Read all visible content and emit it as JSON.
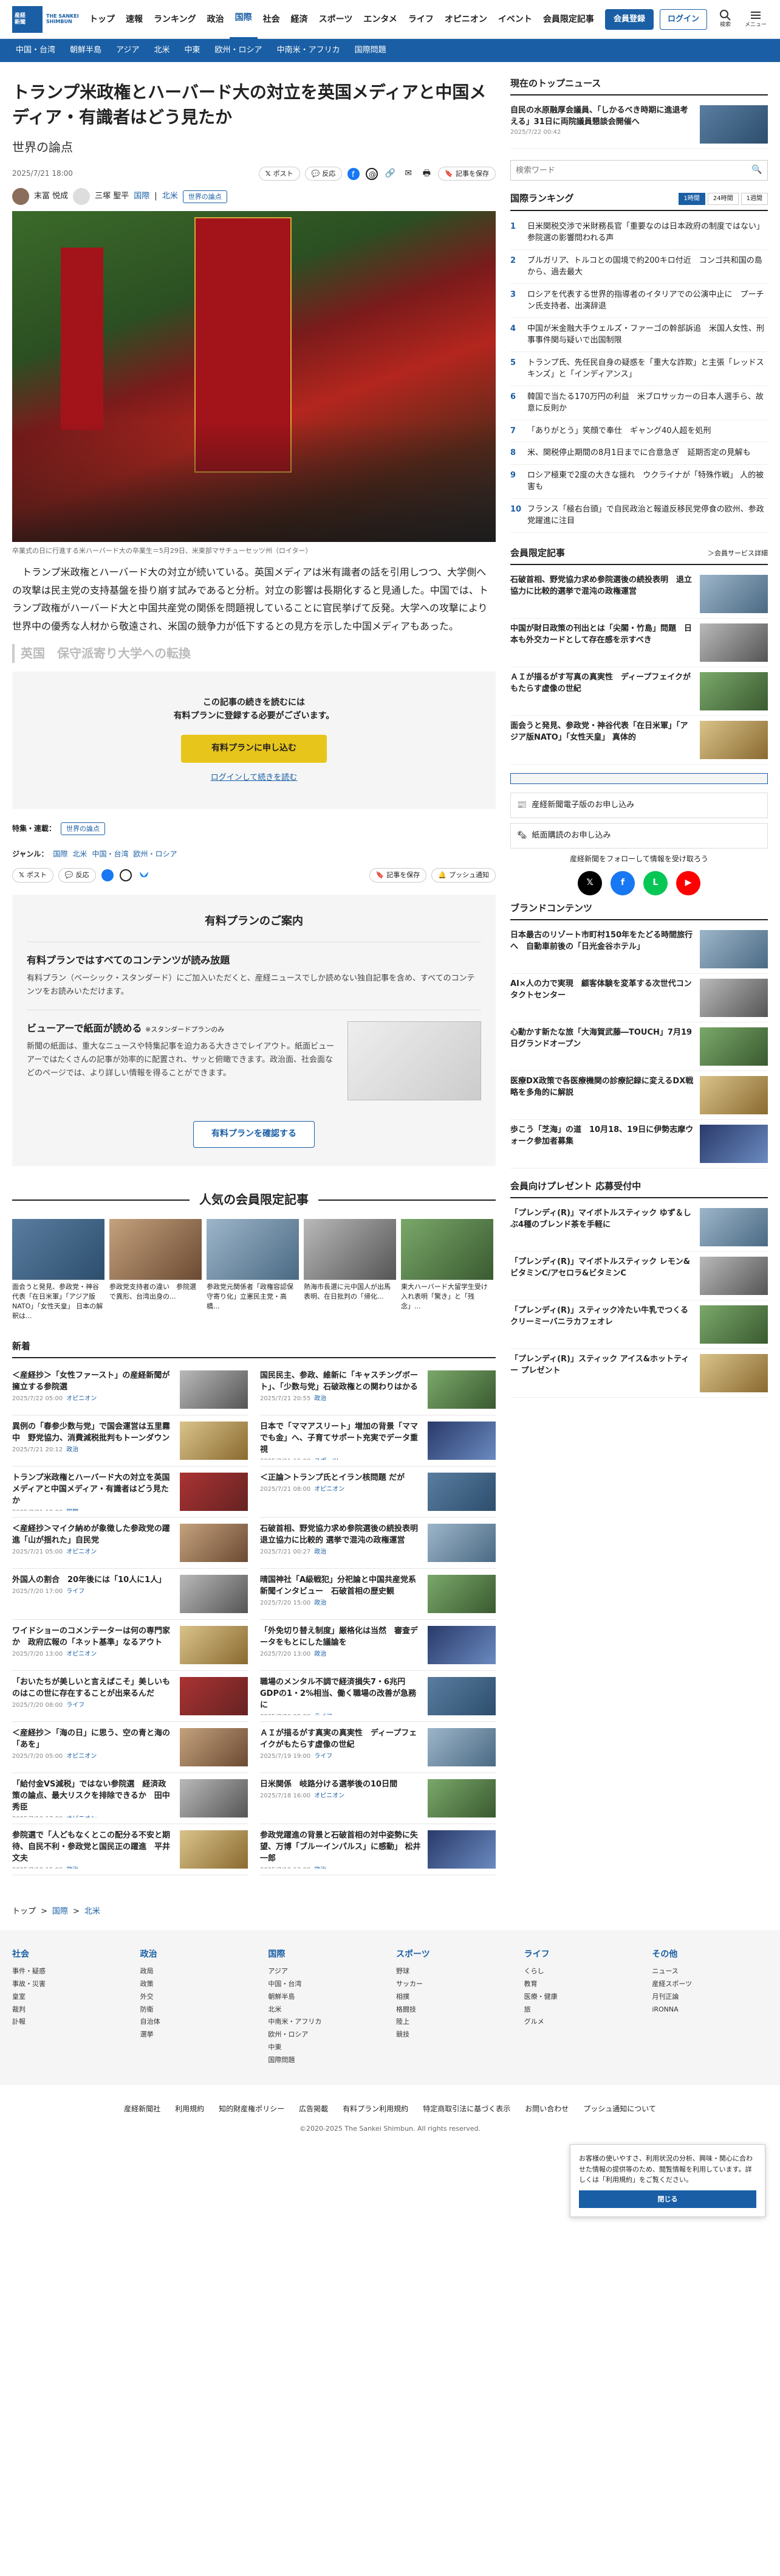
{
  "header": {
    "logo_line1": "産経",
    "logo_line2": "新聞",
    "logo_en": "THE SANKEI SHIMBUN",
    "nav": [
      "トップ",
      "速報",
      "ランキング",
      "政治",
      "国際",
      "社会",
      "経済",
      "スポーツ",
      "エンタメ",
      "ライフ",
      "オピニオン",
      "イベント",
      "会員限定記事"
    ],
    "member_btn": "会員登録",
    "login_btn": "ログイン",
    "search_label": "検索",
    "menu_label": "メニュー"
  },
  "subnav": [
    "中国・台湾",
    "朝鮮半島",
    "アジア",
    "北米",
    "中東",
    "欧州・ロシア",
    "中南米・アフリカ",
    "国際問題"
  ],
  "article": {
    "title": "トランプ米政権とハーバード大の対立を英国メディアと中国メディア・有識者はどう見たか",
    "subtitle": "世界の論点",
    "date": "2025/7/21 18:00",
    "post": "ポスト",
    "repost": "反応",
    "save": "記事を保存",
    "author1": "末冨 悦成",
    "author2": "三塚 聖平",
    "cat1": "国際",
    "cat2": "北米",
    "tag": "世界の論点",
    "caption": "卒業式の日に行進する米ハーバード大の卒業生＝5月29日、米東部マサチューセッツ州（ロイター）",
    "para1": "トランプ米政権とハーバード大の対立が続いている。英国メディアは米有識者の話を引用しつつ、大学側への攻撃は民主党の支持基盤を掛り崩す試みであると分析。対立の影響は長期化すると見通した。中国では、トランプ政権がハーバード大と中国共産党の関係を問題視していることに官民挙げて反発。大学への攻撃により世界中の優秀な人材から敬遠され、米国の競争力が低下するとの見方を示した中国メディアもあった。",
    "fade_heading": "英国　保守派寄り大学への転換",
    "pay_line1": "この記事の続きを読むには",
    "pay_line2": "有料プランに登録する必要がございます。",
    "pay_btn": "有料プランに申し込む",
    "pay_login": "ログインして続きを読む",
    "feature_label": "特集・連載：",
    "feature_tag": "世界の論点",
    "genre_label": "ジャンル：",
    "genres": [
      "国際",
      "北米",
      "中国・台湾",
      "欧州・ロシア"
    ],
    "save2": "記事を保存",
    "push": "プッシュ通知"
  },
  "plans": {
    "title": "有料プランのご案内",
    "h1": "有料プランではすべてのコンテンツが読み放題",
    "p1": "有料プラン（ベーシック・スタンダード）にご加入いただくと、産経ニュースでしか読めない独自記事を含め、すべてのコンテンツをお読みいただけます。",
    "h2": "ビューアーで紙面が読める",
    "h2note": "※スタンダードプランのみ",
    "p2": "新聞の紙面は、重大なニュースや特集記事を迫力ある大きさでレイアウト。紙面ビューアーではたくさんの記事が効率的に配置され、サッと俯瞰できます。政治面、社会面などのページでは、より詳しい情報を得ることができます。",
    "btn": "有料プランを確認する"
  },
  "popular": {
    "title": "人気の会員限定記事",
    "items": [
      "面会うと発見、参政党・神谷代表「在日米軍」「アジア版NATO」「女性天皇」 日本の解釈は...",
      "参政党支持者の違い　参院選で異形、台湾出身の...",
      "参政党元関係者「政権容認保守寄り化」立憲民主党・高橋...",
      "熱海市長選に元中国人が出馬表明、在日批判の「帰化...",
      "東大ハーバード大留学生受け入れ表明「驚き」と「残念」..."
    ]
  },
  "news": {
    "title": "新着",
    "items": [
      {
        "t": "＜産経抄＞「女性ファースト」の産経新聞が擁立する参院選",
        "d": "2025/7/22 05:00",
        "c": "オピニオン"
      },
      {
        "t": "国民民主、参政、維新に「キャスチングボート」、「少数与党」石破政権との関わりはかる",
        "d": "2025/7/21 20:55",
        "c": "政治"
      },
      {
        "t": "異例の「春参少数与党」で国会運営は五里霧中　野党協力、消費減税批判もトーンダウン",
        "d": "2025/7/21 20:12",
        "c": "政治"
      },
      {
        "t": "日本で「ママアスリート」増加の背景「ママでも金」へ、子育てサポート充実でデータ重視",
        "d": "2025/7/21 19:00",
        "c": "スポーツ"
      },
      {
        "t": "トランプ米政権とハーバード大の対立を英国メディアと中国メディア・有識者はどう見たか",
        "d": "2025/7/21 18:00",
        "c": "国際"
      },
      {
        "t": "＜正論＞トランプ氏とイラン核問題 だが",
        "d": "2025/7/21 08:00",
        "c": "オピニオン"
      },
      {
        "t": "＜産経抄＞マイク納めが象徴した参政党の躍進「山が揺れた」自民党",
        "d": "2025/7/21 05:00",
        "c": "オピニオン"
      },
      {
        "t": "石破首相、野党協力求め参院選後の続投表明　退立協力に比較的 選挙で混沌の政権運営",
        "d": "2025/7/21 00:27",
        "c": "政治"
      },
      {
        "t": "外国人の割合　20年後には「10人に1人」",
        "d": "2025/7/20 17:00",
        "c": "ライフ"
      },
      {
        "t": "晴国神社「A級戦犯」分祀論と中国共産党系新聞インタビュー　石破首相の歴史観",
        "d": "2025/7/20 15:00",
        "c": "政治"
      },
      {
        "t": "ワイドショーのコメンテーターは何の専門家か　政府広報の「ネット基準」なるアウト",
        "d": "2025/7/20 13:00",
        "c": "オピニオン"
      },
      {
        "t": "「外免切り替え制度」厳格化は当然　審査データをもとにした議論を",
        "d": "2025/7/20 13:00",
        "c": "政治"
      },
      {
        "t": "「おいたちが美しいと言えばこそ」美しいものはこの世に存在することが出来るんだ",
        "d": "2025/7/20 08:00",
        "c": "ライフ"
      },
      {
        "t": "職場のメンタル不調で経済損失7・6兆円　GDPの1・2%相当、働く職場の改善が急務に",
        "d": "2025/7/20 08:00",
        "c": "ライフ"
      },
      {
        "t": "＜産経抄＞「海の日」に思う、空の青と海の「あを」",
        "d": "2025/7/20 05:00",
        "c": "オピニオン"
      },
      {
        "t": "ＡＩが描るがす真実の真実性　ディープフェイクがもたらす虚像の世紀",
        "d": "2025/7/19 19:00",
        "c": "ライフ"
      },
      {
        "t": "「給付金VS減税」ではない参院選　経済政策の論点、最大リスクを排除できるか　田中秀臣",
        "d": "2025/7/19 17:00",
        "c": "オピニオン"
      },
      {
        "t": "日米関係　岐路分ける選挙後の10日間",
        "d": "2025/7/18 16:00",
        "c": "オピニオン"
      },
      {
        "t": "参院選で「人どもなくとこの配分る不安と期待、自民不利・参政党と国民正の躍進　平井文夫",
        "d": "2025/7/19 15:00",
        "c": "政治"
      },
      {
        "t": "参政党躍進の背景と石破首相の対中姿勢に失望、万博「ブルーインパルス」に感動」 松井一郎",
        "d": "2025/7/19 13:00",
        "c": "政治"
      }
    ]
  },
  "breadcrumb": [
    "トップ",
    "国際",
    "北米"
  ],
  "footer": {
    "cols": [
      {
        "h": "社会",
        "items": [
          "事件・疑惑",
          "事故・災害",
          "皇室",
          "裁判",
          "訃報"
        ]
      },
      {
        "h": "政治",
        "items": [
          "政局",
          "政策",
          "外交",
          "防衛",
          "自治体",
          "選挙"
        ]
      },
      {
        "h": "国際",
        "items": [
          "アジア",
          "中国・台湾",
          "朝鮮半島",
          "北米",
          "中南米・アフリカ",
          "欧州・ロシア",
          "中東",
          "国際問題"
        ]
      },
      {
        "h": "スポーツ",
        "items": [
          "野球",
          "サッカー",
          "相撲",
          "格闘技",
          "陸上",
          "競技"
        ]
      },
      {
        "h": "ライフ",
        "items": [
          "くらし",
          "教育",
          "医療・健康",
          "旅",
          "グルメ"
        ]
      },
      {
        "h": "その他",
        "items": [
          "ニュース",
          "産経スポーツ",
          "月刊正論",
          "iRONNA"
        ]
      }
    ],
    "links": [
      "産経新聞社",
      "利用規約",
      "知的財産権ポリシー",
      "広告掲載",
      "有料プラン利用規約",
      "特定商取引法に基づく表示",
      "お問い合わせ",
      "プッシュ通知について"
    ],
    "copyright": "©2020-2025 The Sankei Shimbun. All rights reserved."
  },
  "side": {
    "now_top": "現在のトップニュース",
    "now_item": "自民の水原融厚会議員、「しかるべき時期に進退考える」31日に両院議員懇談会開催へ",
    "now_date": "2025/7/22 00:42",
    "search_placeholder": "検索ワード",
    "ranking_title": "国際ランキング",
    "ranking_tabs": [
      "1時間",
      "24時間",
      "1週間"
    ],
    "ranking": [
      "日米関税交渉で米財務長官「重要なのは日本政府の制度ではない」 参院選の影響問われる声",
      "ブルガリア、トルコとの国境で約200キロ付近　コンゴ共和国の島から、過去最大",
      "ロシアを代表する世界的指導者のイタリアでの公演中止に　プーチン氏支持者、出演辞退",
      "中国が米金融大手ウェルズ・ファーゴの幹部訴追　米国人女性、刑事事件関与疑いで出国制限",
      "トランプ氏、先任民自身の疑惑を「重大な詐欺」と主張「レッドスキンズ」と「インディアンス」",
      "韓国で当たる170万円の利益　米ブロサッカーの日本人選手ら、故意に反則か",
      "「ありがとう」笑顔で奉仕　ギャング40人超を処刑",
      "米、関税停止期間の8月1日までに合意急ぎ　延期否定の見解も",
      "ロシア極東で2度の大きな揺れ　ウクライナが「特殊作戦」 人的被害も",
      "フランス「極右台頭」で自民政治と報道反移民党停食の欧州、参政党躍進に注目"
    ],
    "members_title": "会員限定記事",
    "members_more": "＞会員サービス詳細",
    "members": [
      "石破首相、野党協力求め参院選後の続投表明　退立協力に比較的選挙で混沌の政権運営",
      "中国が財日政策の刊出とは「尖閣・竹島」問題　日本も外交カードとして存在感を示すべき",
      "ＡＩが描るがす写真の真実性　ディープフェイクがもたらす虚像の世紀",
      "面会うと発見、参政党・神谷代表「在日米軍」「アジア版NATO」「女性天皇」 真体的"
    ],
    "service1": "産経新聞電子版のお申し込み",
    "service2": "紙面購読のお申し込み",
    "follow": "産経新聞をフォローして情報を受け取ろう",
    "brand_title": "ブランドコンテンツ",
    "brand": [
      "日本最古のリゾート市町村150年をたどる時間旅行へ　自動車前後の「日光金谷ホテル」",
      "AI×人の力で実現　顧客体験を変革する次世代コンタクトセンター",
      "心動かす新たな旅「大海賀武藤―TOUCH」7月19日グランドオープン",
      "医療DX政策で各医療機関の診療記録に変えるDX戦略を多角的に解説",
      "歩こう「芝海」の道　10月18、19日に伊勢志摩ウォーク参加者募集"
    ],
    "present_title": "会員向けプレゼント 応募受付中",
    "present": [
      "「プレンディ(R)」マイボトルスティック ゆず＆しぶ4種のブレンド茶を手軽に",
      "「プレンディ(R)」マイボトルスティック レモン&ビタミンC/アセロラ&ビタミンC",
      "「プレンディ(R)」スティック冷たい牛乳でつくるクリーミーバニラカフェオレ",
      "「プレンディ(R)」スティック アイス&ホットティー プレゼント"
    ]
  },
  "cookie": {
    "text": "お客様の使いやすさ、利用状況の分析、興味・関心に合わせた情報の提供等のため、閲覧情報を利用しています。詳しくは「利用規約」をご覧ください。",
    "btn": "閉じる"
  }
}
